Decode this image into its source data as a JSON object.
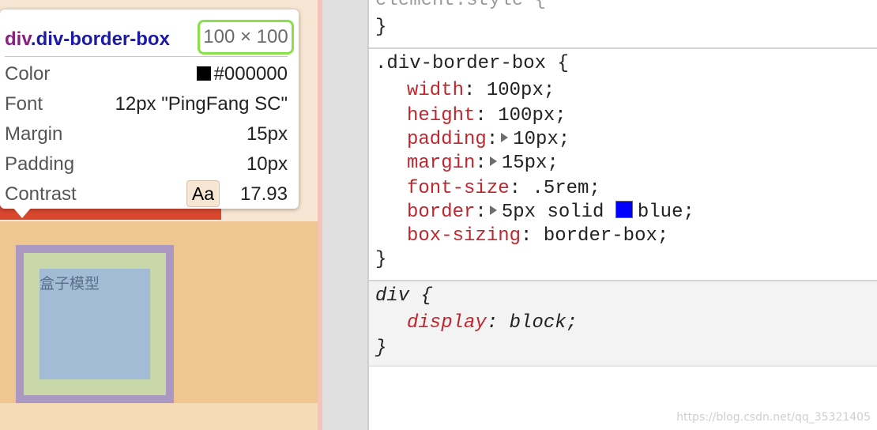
{
  "tooltip": {
    "tag": "div",
    "class": ".div-border-box",
    "size": "100 × 100",
    "rows": {
      "color": {
        "label": "Color",
        "value": "#000000"
      },
      "font": {
        "label": "Font",
        "value": "12px \"PingFang SC\""
      },
      "margin": {
        "label": "Margin",
        "value": "15px"
      },
      "padding": {
        "label": "Padding",
        "value": "10px"
      },
      "contrast": {
        "label": "Contrast",
        "badge": "Aa",
        "value": "17.93"
      }
    }
  },
  "preview": {
    "box_text": "盒子模型",
    "colors": {
      "margin": "#efc690",
      "border": "#aa98c2",
      "padding": "#c9d8a9",
      "content": "#a3bcd6"
    }
  },
  "styles": {
    "element_style": {
      "selector": "element.style {",
      "close": "}"
    },
    "rule1": {
      "selector": ".div-border-box {",
      "decls": [
        {
          "prop": "width",
          "value": "100px;"
        },
        {
          "prop": "height",
          "value": "100px;"
        },
        {
          "prop": "padding",
          "value": "10px;"
        },
        {
          "prop": "margin",
          "value": "15px;"
        },
        {
          "prop": "font-size",
          "value": ".5rem;"
        },
        {
          "prop": "border",
          "value": "5px solid ",
          "color_name": "blue;",
          "color": "#0000ff"
        },
        {
          "prop": "box-sizing",
          "value": "border-box;"
        }
      ],
      "close": "}"
    },
    "rule2": {
      "selector": "div {",
      "decls": [
        {
          "prop": "display",
          "value": "block;"
        }
      ],
      "close": "}"
    }
  },
  "watermark": "https://blog.csdn.net/qq_35321405"
}
